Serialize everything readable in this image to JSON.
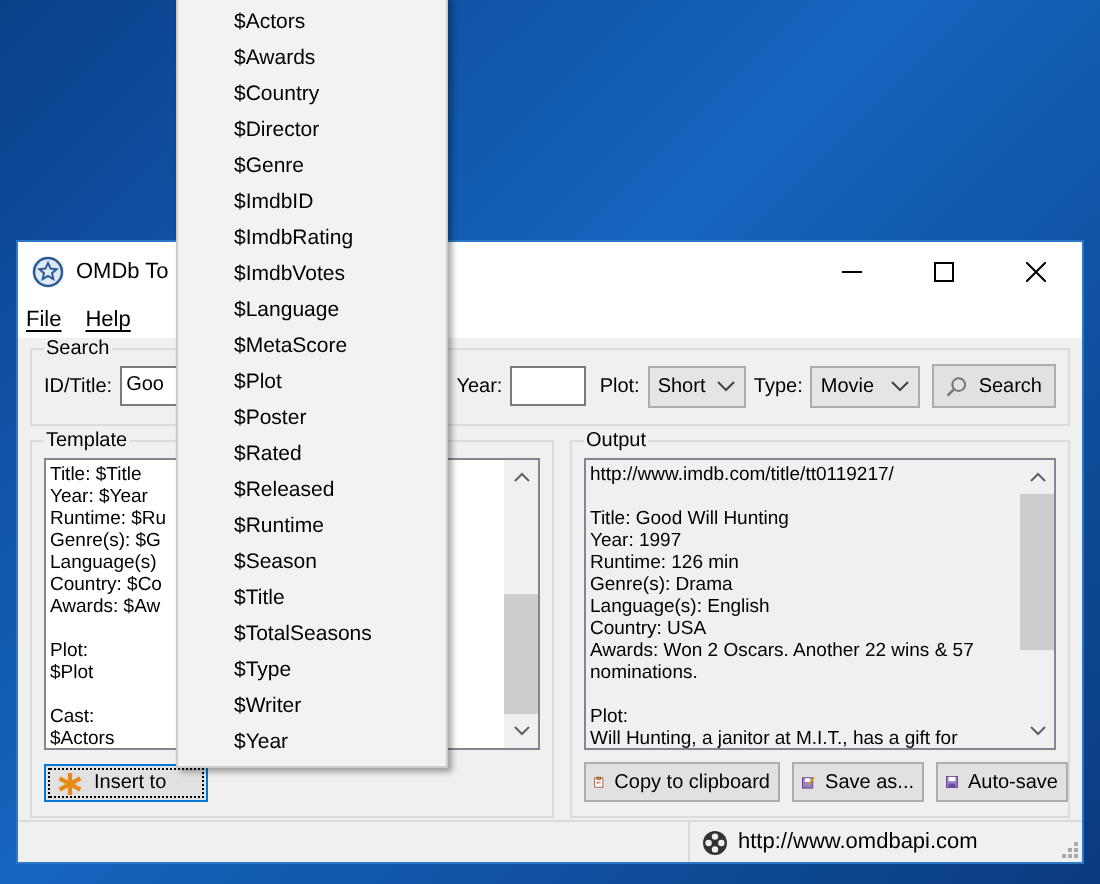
{
  "window": {
    "title": "OMDb To"
  },
  "menu_bar": [
    "File",
    "Help"
  ],
  "search": {
    "group_label": "Search",
    "id_title_label": "ID/Title:",
    "id_title_value": "Goo",
    "year_label": "Year:",
    "plot_label": "Plot:",
    "plot_value": "Short",
    "type_label": "Type:",
    "type_value": "Movie",
    "search_button": "Search"
  },
  "template": {
    "group_label": "Template",
    "blocks": [
      [
        "Title: $Title",
        "Year: $Year",
        "Runtime: $Ru",
        "Genre(s): $G",
        "Language(s)",
        "Country: $Co",
        "Awards: $Aw"
      ],
      [
        "Plot:",
        "$Plot"
      ],
      [
        "Cast:",
        "$Actors"
      ]
    ],
    "insert_button": "Insert to"
  },
  "output": {
    "group_label": "Output",
    "blocks": [
      [
        "http://www.imdb.com/title/tt0119217/"
      ],
      [
        "Title: Good Will Hunting",
        "Year: 1997",
        "Runtime: 126 min",
        "Genre(s): Drama",
        "Language(s): English",
        "Country: USA",
        "Awards: Won 2 Oscars. Another 22 wins & 57 nominations."
      ],
      [
        "Plot:",
        "Will Hunting, a janitor at M.I.T., has a gift for"
      ]
    ],
    "buttons": [
      {
        "kind": "copy",
        "label": "Copy to clipboard"
      },
      {
        "kind": "save-as",
        "label": "Save as..."
      },
      {
        "kind": "auto-save",
        "label": "Auto-save"
      }
    ]
  },
  "status_bar": {
    "url": "http://www.omdbapi.com"
  },
  "token_menu": [
    "$Actors",
    "$Awards",
    "$Country",
    "$Director",
    "$Genre",
    "$ImdbID",
    "$ImdbRating",
    "$ImdbVotes",
    "$Language",
    "$MetaScore",
    "$Plot",
    "$Poster",
    "$Rated",
    "$Released",
    "$Runtime",
    "$Season",
    "$Title",
    "$TotalSeasons",
    "$Type",
    "$Writer",
    "$Year"
  ]
}
